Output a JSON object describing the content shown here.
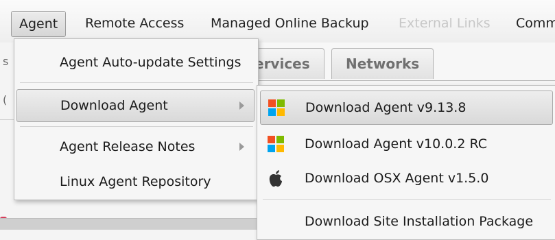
{
  "menubar": {
    "items": [
      {
        "label": "Agent",
        "state": "active"
      },
      {
        "label": "Remote Access",
        "state": "normal"
      },
      {
        "label": "Managed Online Backup",
        "state": "normal"
      },
      {
        "label": "External Links",
        "state": "disabled"
      },
      {
        "label": "Comm",
        "state": "normal"
      }
    ]
  },
  "background": {
    "tabs": [
      "ervices",
      "Networks"
    ],
    "left_glyphs": [
      "s",
      "("
    ]
  },
  "agent_menu": {
    "items": [
      {
        "label": "Agent Auto-update Settings",
        "has_submenu": false
      },
      {
        "label": "Download Agent",
        "has_submenu": true,
        "state": "hover"
      },
      {
        "label": "Agent Release Notes",
        "has_submenu": true
      },
      {
        "label": "Linux Agent Repository",
        "has_submenu": false
      }
    ]
  },
  "download_submenu": {
    "items": [
      {
        "label": "Download Agent v9.13.8",
        "icon": "windows-icon",
        "state": "hover"
      },
      {
        "label": "Download Agent v10.0.2 RC",
        "icon": "windows-icon"
      },
      {
        "label": "Download OSX Agent v1.5.0",
        "icon": "apple-icon"
      },
      {
        "label": "Download Site Installation Package",
        "icon": ""
      }
    ]
  },
  "colors": {
    "windows_red": "#f25022",
    "windows_green": "#7fba00",
    "windows_blue": "#00a4ef",
    "windows_yellow": "#ffb900",
    "apple_gray": "#333333",
    "disabled_text": "#c7c7c7"
  }
}
